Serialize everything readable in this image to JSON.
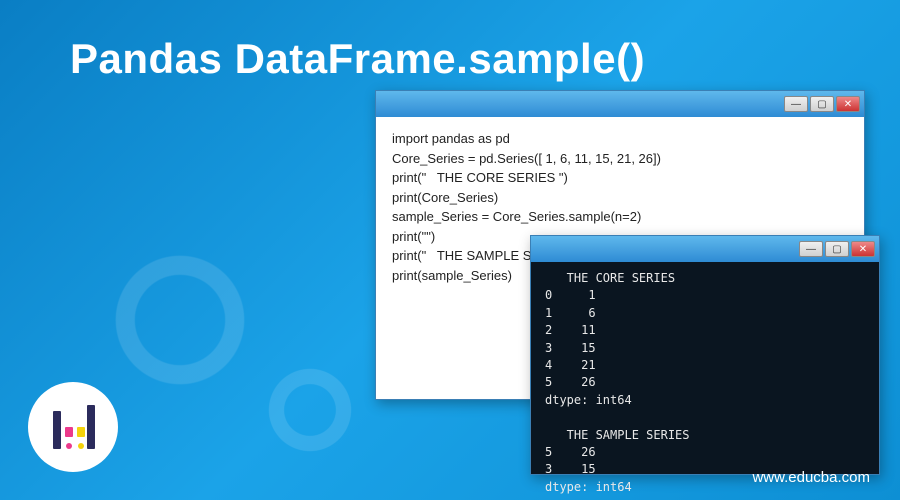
{
  "title": "Pandas DataFrame.sample()",
  "url": "www.educba.com",
  "editor": {
    "lines": [
      "import pandas as pd",
      "Core_Series = pd.Series([ 1, 6, 11, 15, 21, 26])",
      "print(\"   THE CORE SERIES \")",
      "print(Core_Series)",
      "sample_Series = Core_Series.sample(n=2)",
      "print(\"\")",
      "print(\"   THE SAMPLE SERIES \")",
      "print(sample_Series)"
    ]
  },
  "console": {
    "lines": [
      "   THE CORE SERIES ",
      "0     1",
      "1     6",
      "2    11",
      "3    15",
      "4    21",
      "5    26",
      "dtype: int64",
      "",
      "   THE SAMPLE SERIES ",
      "5    26",
      "3    15",
      "dtype: int64"
    ]
  },
  "window_controls": {
    "minimize": "—",
    "maximize": "▢",
    "close": "✕"
  }
}
